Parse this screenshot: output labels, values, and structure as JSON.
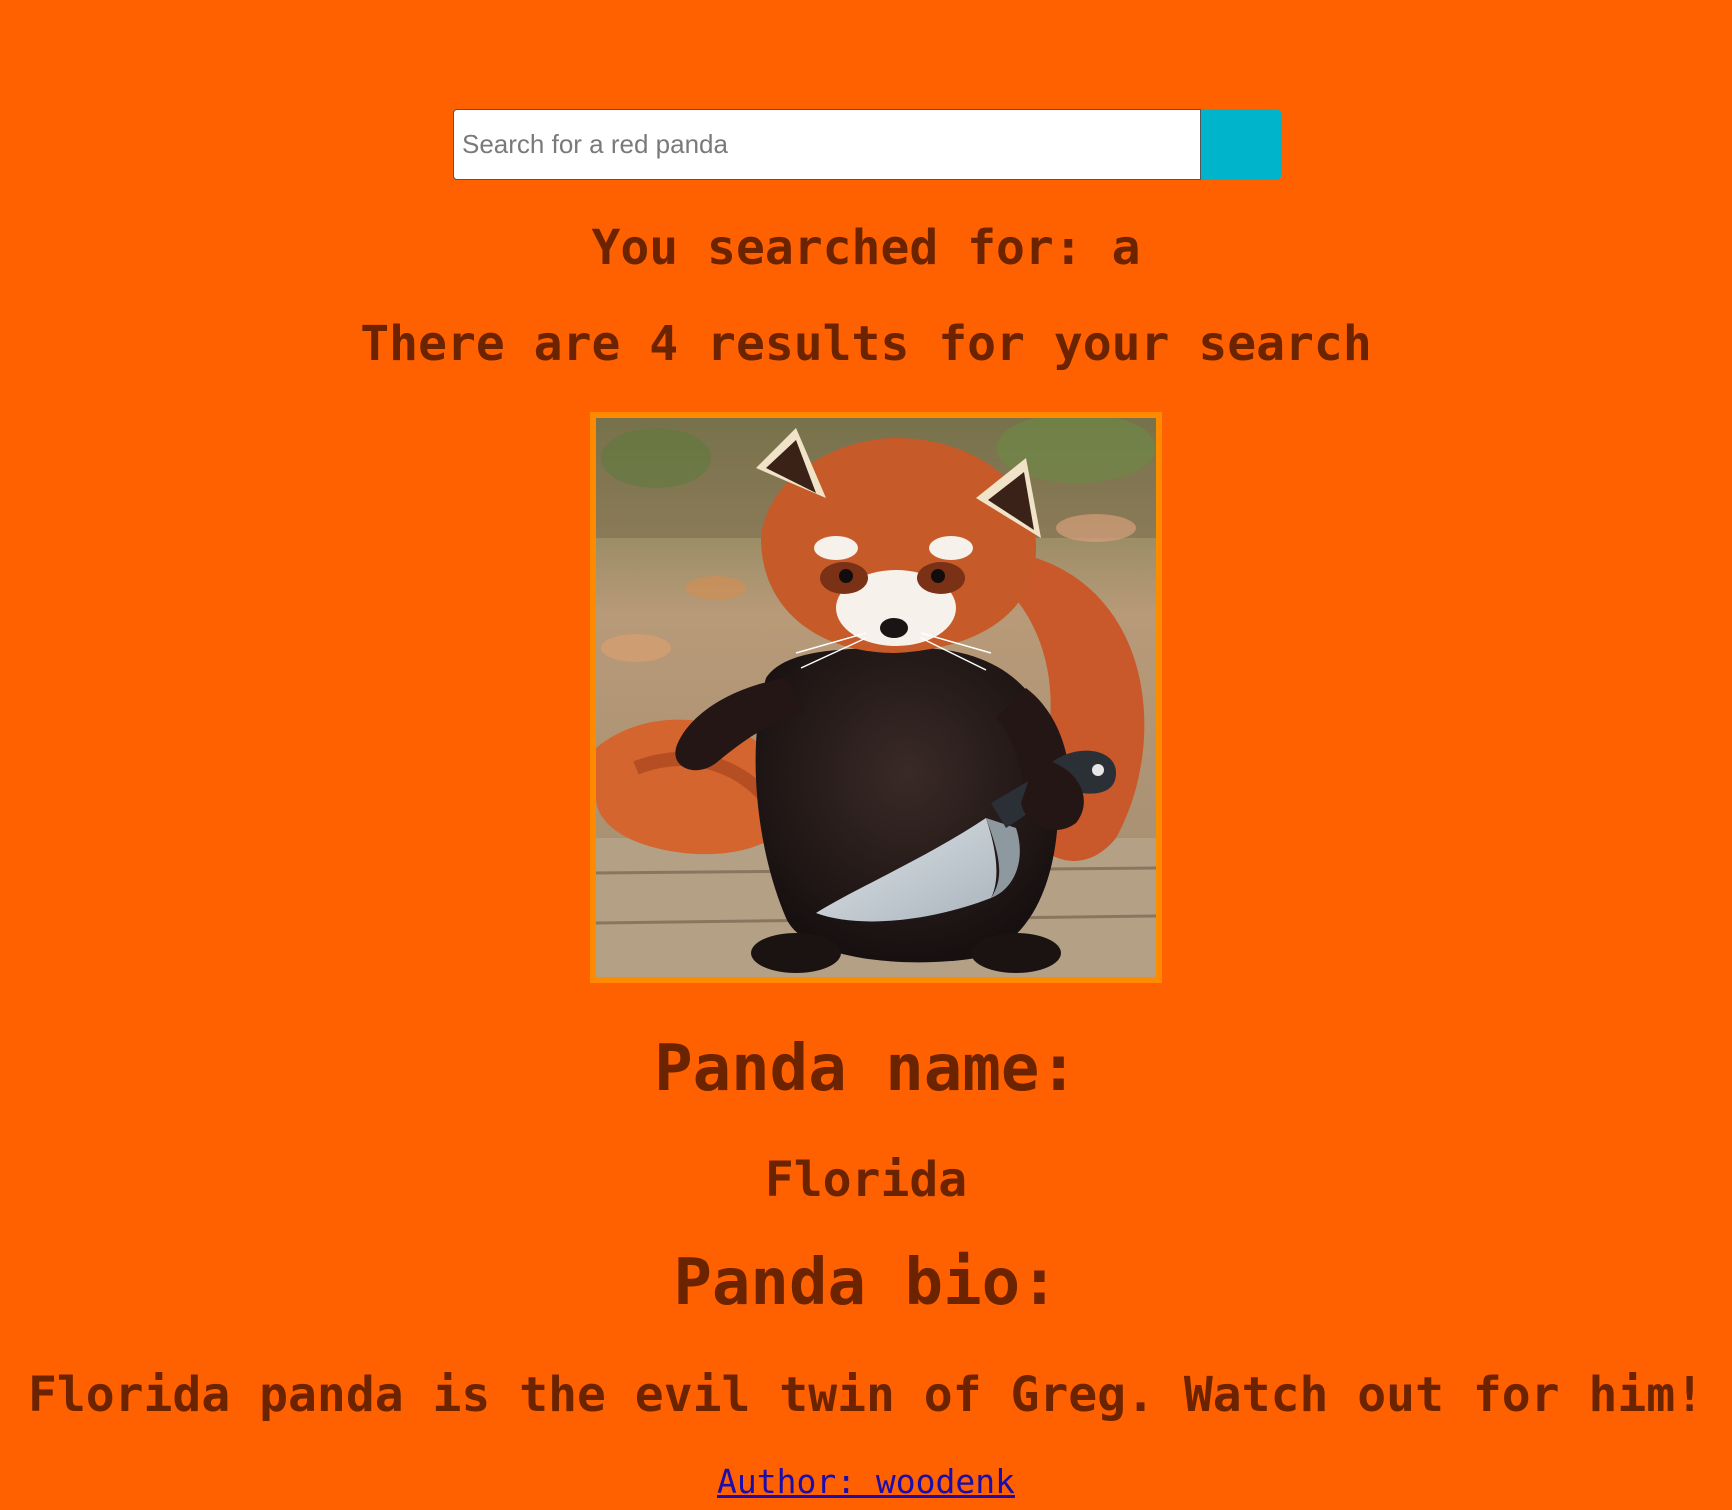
{
  "search": {
    "placeholder": "Search for a red panda",
    "value": ""
  },
  "results": {
    "searched_text": "You searched for: a",
    "count_text": "There are 4 results for your search"
  },
  "panda": {
    "image_icon": "red-panda-holding-knife",
    "name_heading": "Panda name:",
    "name": "Florida",
    "bio_heading": "Panda bio:",
    "bio": "Florida panda is the evil twin of Greg. Watch out for him!"
  },
  "footer": {
    "author_text": "Author: woodenk"
  },
  "colors": {
    "background": "#ff6000",
    "text": "#6b2300",
    "search_button": "#00b4cc",
    "image_border": "#ff8a00",
    "link": "#1a0dab"
  }
}
